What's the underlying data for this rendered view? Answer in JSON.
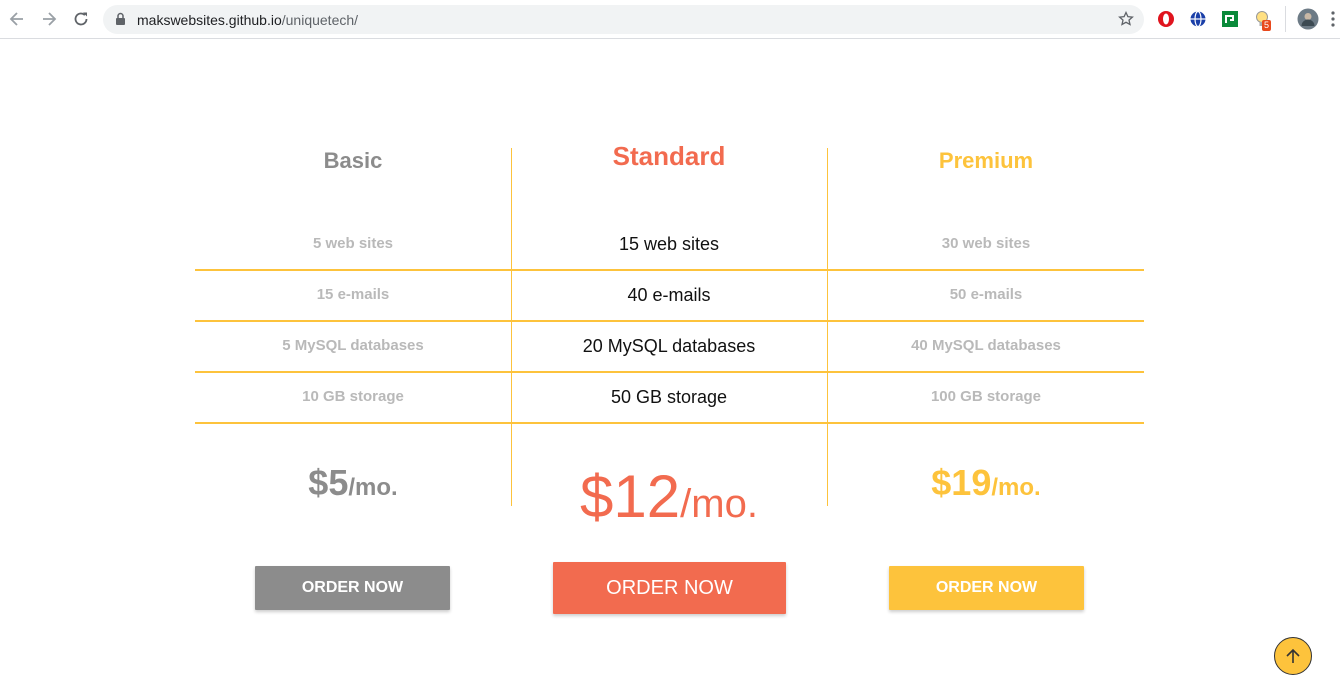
{
  "browser": {
    "url_host": "makswebsites.github.io",
    "url_path": "/uniquetech/",
    "extension_badge": "5"
  },
  "plans": [
    {
      "name": "Basic",
      "features": [
        "5 web sites",
        "15 e-mails",
        "5 MySQL databases",
        "10 GB storage"
      ],
      "price": "$5",
      "per": "/mo.",
      "button": "ORDER NOW",
      "color": "#8c8c8c"
    },
    {
      "name": "Standard",
      "features": [
        "15 web sites",
        "40 e-mails",
        "20 MySQL databases",
        "50 GB storage"
      ],
      "price": "$12",
      "per": "/mo.",
      "button": "ORDER NOW",
      "color": "#f26b4f"
    },
    {
      "name": "Premium",
      "features": [
        "30 web sites",
        "50 e-mails",
        "40 MySQL databases",
        "100 GB storage"
      ],
      "price": "$19",
      "per": "/mo.",
      "button": "ORDER NOW",
      "color": "#fdc33c"
    }
  ],
  "colors": {
    "accent_line": "#fdc33c",
    "muted_text": "#b9b9b9"
  },
  "icons": {
    "back": "arrow-left-icon",
    "forward": "arrow-right-icon",
    "reload": "reload-icon",
    "lock": "lock-icon",
    "bookmark": "star-icon",
    "scroll_top": "arrow-up-icon"
  }
}
